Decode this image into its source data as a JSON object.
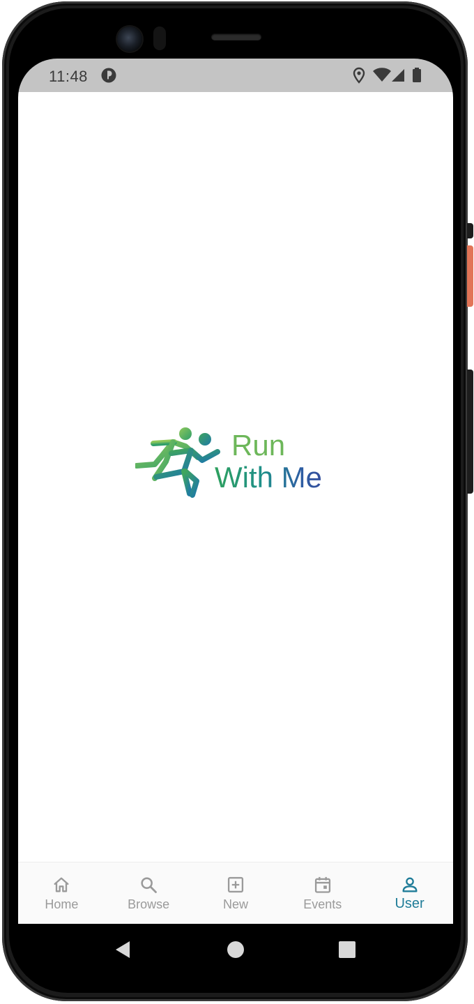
{
  "status_bar": {
    "time": "11:48"
  },
  "logo": {
    "line1": "Run",
    "line2": "With Me"
  },
  "bottom_nav": {
    "items": [
      {
        "label": "Home",
        "icon": "home-icon",
        "active": false
      },
      {
        "label": "Browse",
        "icon": "search-icon",
        "active": false
      },
      {
        "label": "New",
        "icon": "add-box-icon",
        "active": false
      },
      {
        "label": "Events",
        "icon": "calendar-icon",
        "active": false
      },
      {
        "label": "User",
        "icon": "person-icon",
        "active": true
      }
    ]
  },
  "colors": {
    "accent": "#1f7c98",
    "inactive": "#9a9a9a",
    "status_bar": "#c4c4c4",
    "logo_green": "#6db75a",
    "logo_blue": "#354e9c"
  }
}
